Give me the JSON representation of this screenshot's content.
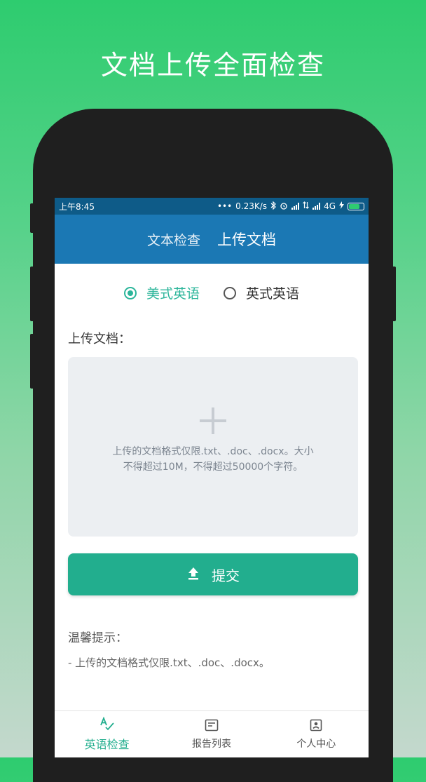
{
  "promo": {
    "title": "文档上传全面检查"
  },
  "status_bar": {
    "time": "上午8:45",
    "dots": "•••",
    "speed": "0.23K/s",
    "network": "4G"
  },
  "header": {
    "tabs": [
      {
        "label": "文本检查",
        "active": false
      },
      {
        "label": "上传文档",
        "active": true
      }
    ]
  },
  "language": {
    "options": [
      {
        "label": "美式英语",
        "selected": true
      },
      {
        "label": "英式英语",
        "selected": false
      }
    ]
  },
  "upload": {
    "label": "上传文档：",
    "hint": "上传的文档格式仅限.txt、.doc、.docx。大小不得超过10M，不得超过50000个字符。"
  },
  "submit": {
    "label": "提交"
  },
  "tips": {
    "title": "温馨提示：",
    "item": "- 上传的文档格式仅限.txt、.doc、.docx。"
  },
  "bottom_nav": {
    "items": [
      {
        "label": "英语检查",
        "active": true,
        "icon": "spellcheck-icon"
      },
      {
        "label": "报告列表",
        "active": false,
        "icon": "report-icon"
      },
      {
        "label": "个人中心",
        "active": false,
        "icon": "profile-icon"
      }
    ]
  },
  "colors": {
    "accent": "#22ae8e",
    "header": "#1b78b4",
    "status_bar": "#0e5b88",
    "background_top": "#2ecc6f"
  }
}
